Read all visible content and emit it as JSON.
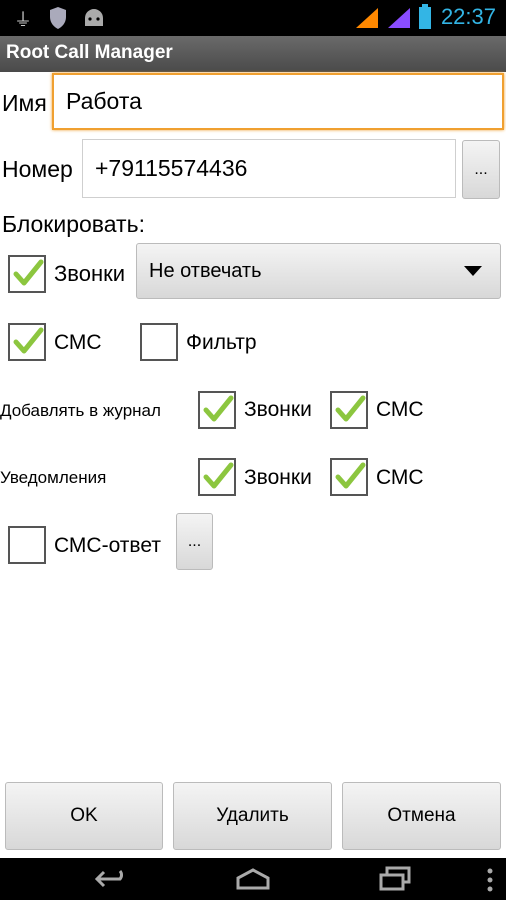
{
  "statusbar": {
    "time": "22:37"
  },
  "app": {
    "title": "Root Call Manager"
  },
  "form": {
    "name_label": "Имя",
    "name_value": "Работа",
    "number_label": "Номер",
    "number_value": "+79115574436",
    "number_more": "...",
    "block_label": "Блокировать:",
    "calls_label": "Звонки",
    "calls_checked": true,
    "action_value": "Не отвечать",
    "sms_label": "СМС",
    "sms_checked": true,
    "filter_label": "Фильтр",
    "filter_checked": false,
    "journal_label": "Добавлять в журнал",
    "journal_calls_label": "Звонки",
    "journal_sms_label": "СМС",
    "notify_label": "Уведомления",
    "notify_calls_label": "Звонки",
    "notify_sms_label": "СМС",
    "smsreply_label": "СМС-ответ",
    "smsreply_checked": false,
    "smsreply_more": "..."
  },
  "buttons": {
    "ok": "OK",
    "delete": "Удалить",
    "cancel": "Отмена"
  },
  "colors": {
    "accent": "#33b5e5",
    "focus": "#f0a030",
    "check": "#8cc63f"
  }
}
